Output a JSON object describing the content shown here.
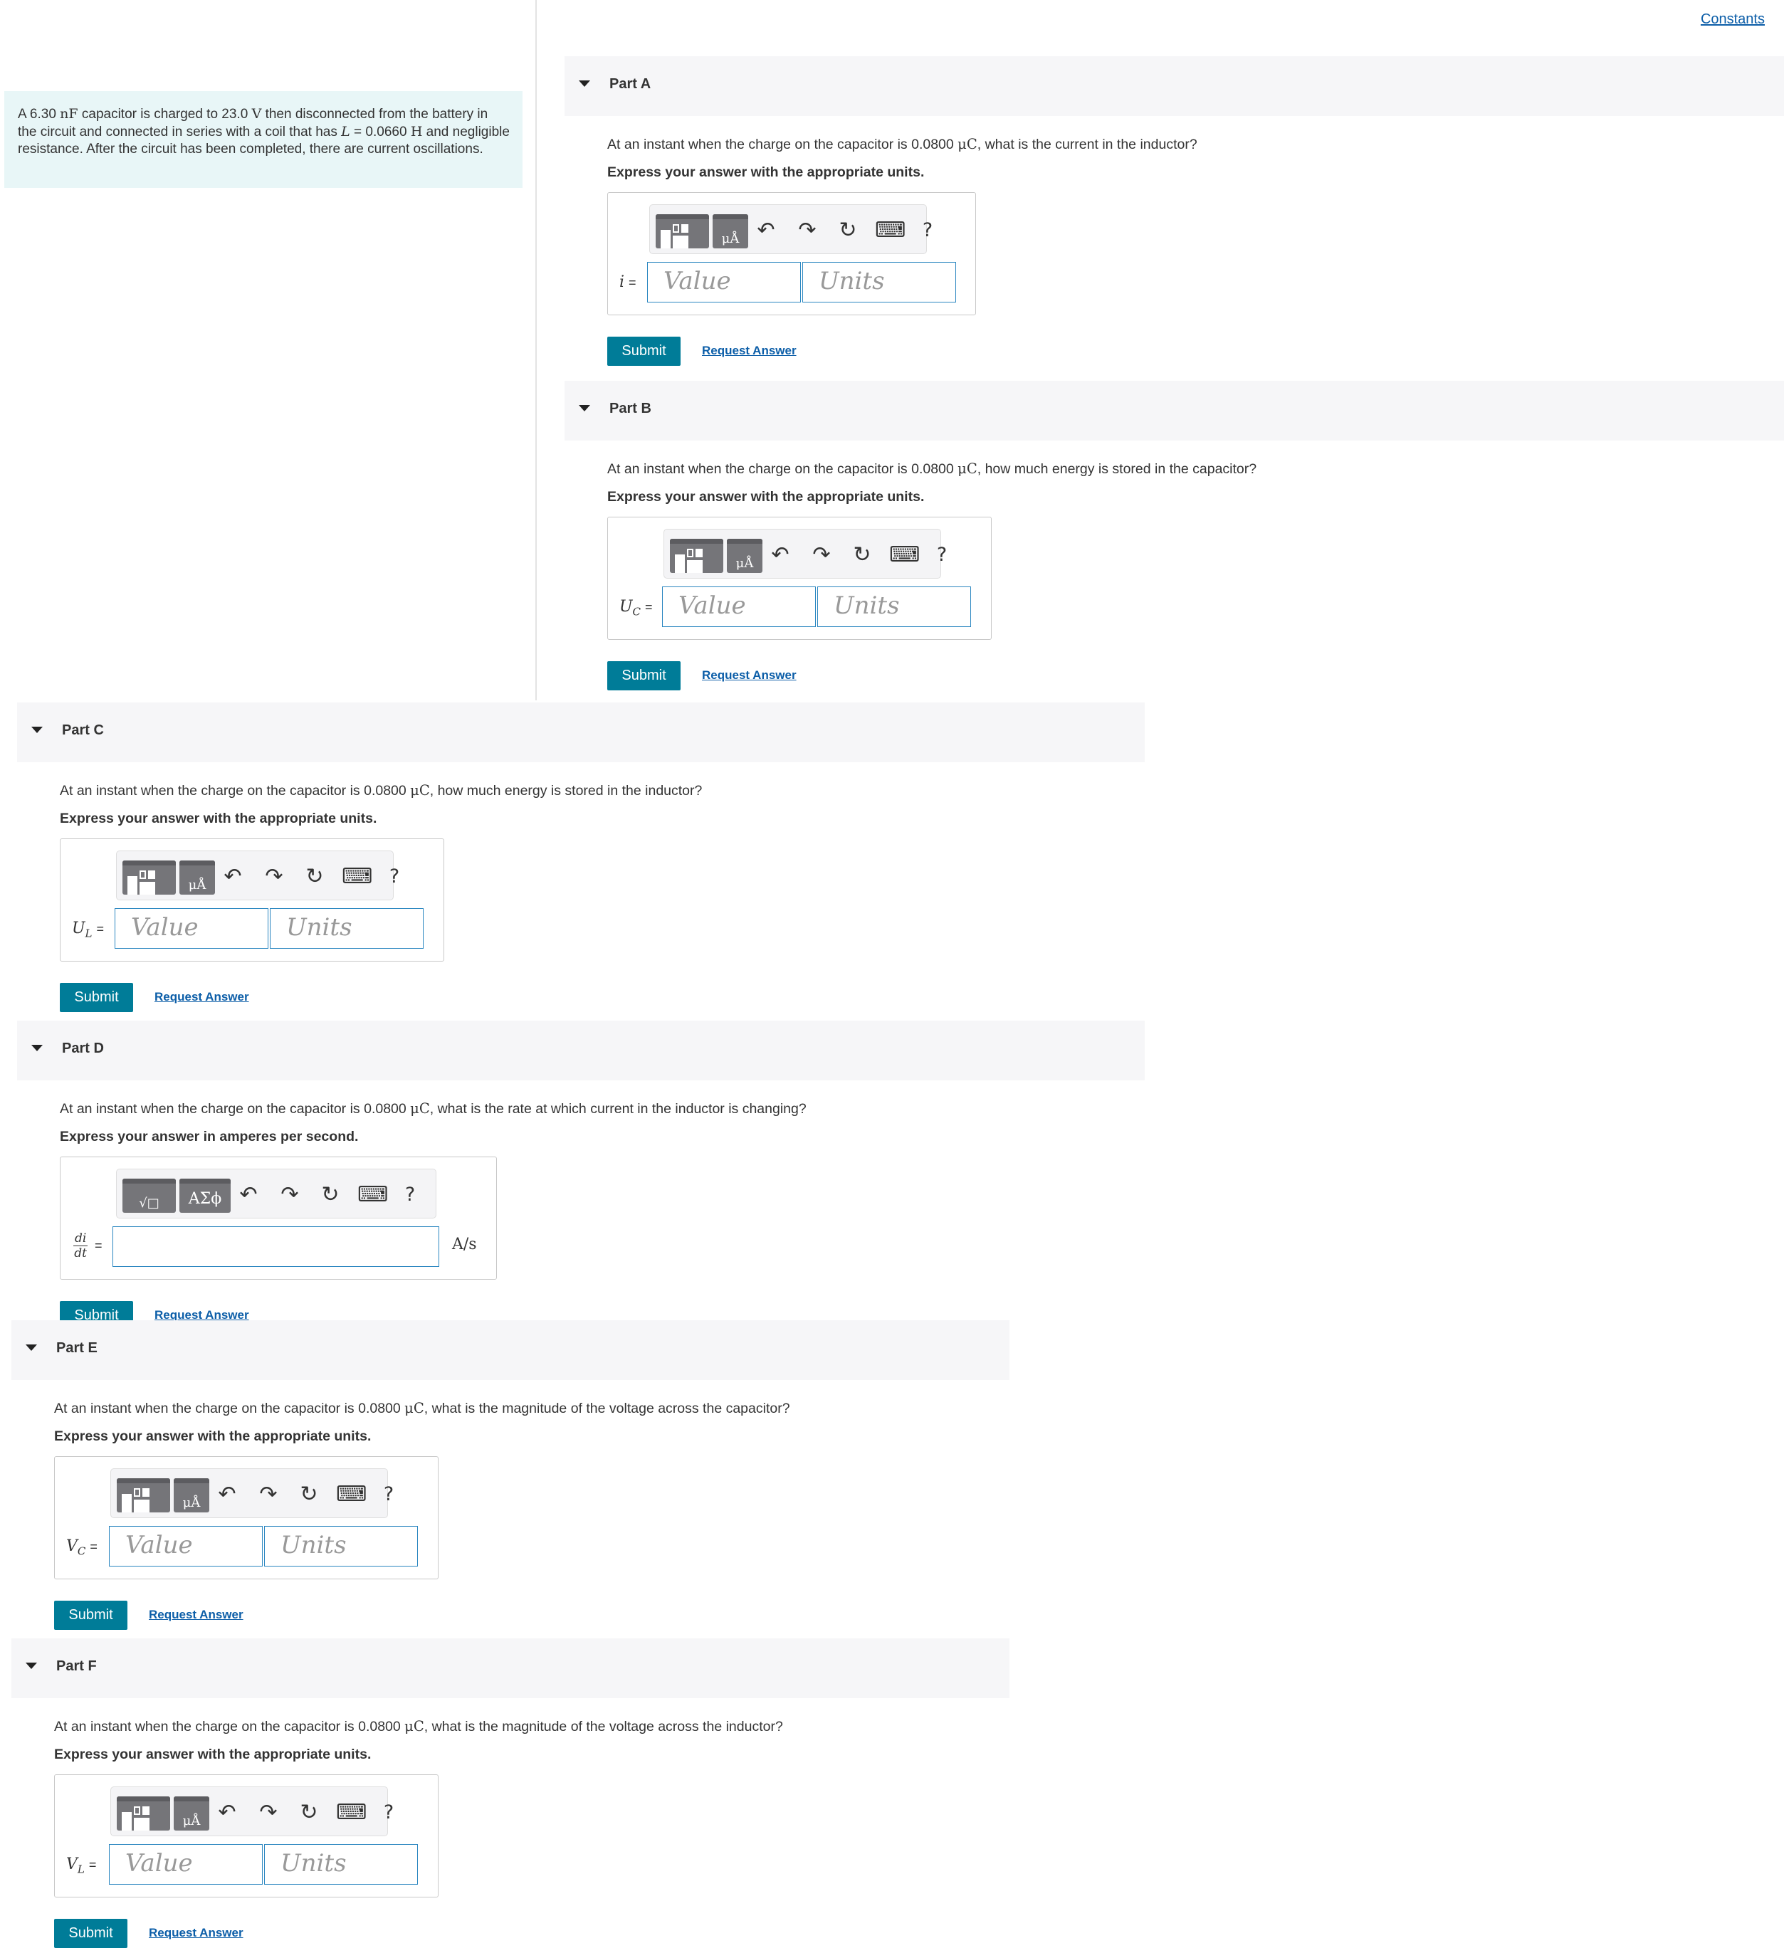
{
  "header": {
    "constants_link": "Constants"
  },
  "intro": {
    "segments": [
      "A 6.30 ",
      "nF",
      " capacitor is charged to 23.0 ",
      "V",
      " then disconnected from the battery in the circuit and connected in series with a coil that has ",
      "L",
      " = 0.0660 ",
      "H",
      " and negligible resistance. After the circuit has been completed, there are current oscillations."
    ]
  },
  "toolbar": {
    "template_icon": "template-icon",
    "units_glyph": "μÅ",
    "math_glyph": "√□",
    "greek_glyph": "ΑΣϕ",
    "undo": "↶",
    "redo": "↷",
    "reset": "↻",
    "keyboard": "⌨",
    "help": "?"
  },
  "common": {
    "instruction_units": "Express your answer with the appropriate units.",
    "value_placeholder": "Value",
    "units_placeholder": "Units",
    "submit": "Submit",
    "request_answer": "Request Answer"
  },
  "parts": [
    {
      "title": "Part A",
      "question_pre": "At an instant when the charge on the capacitor is 0.0800 ",
      "question_unit": "μC",
      "question_post": ", what is the current in the inductor?",
      "var": "i",
      "var_sub": "",
      "equals": "="
    },
    {
      "title": "Part B",
      "question_pre": "At an instant when the charge on the capacitor is 0.0800 ",
      "question_unit": "μC",
      "question_post": ", how much energy is stored in the capacitor?",
      "var": "U",
      "var_sub": "C",
      "equals": "="
    },
    {
      "title": "Part C",
      "question_pre": "At an instant when the charge on the capacitor is 0.0800 ",
      "question_unit": "μC",
      "question_post": ", how much energy is stored in the inductor?",
      "var": "U",
      "var_sub": "L",
      "equals": "="
    },
    {
      "title": "Part D",
      "question_pre": "At an instant when the charge on the capacitor is 0.0800 ",
      "question_unit": "μC",
      "question_post": ", what is the rate at which current in the inductor is changing?",
      "instruction": "Express your answer in amperes per second.",
      "frac_num": "di",
      "frac_den": "dt",
      "equals": "=",
      "unit_suffix": "A/s"
    },
    {
      "title": "Part E",
      "question_pre": "At an instant when the charge on the capacitor is 0.0800 ",
      "question_unit": "μC",
      "question_post": ", what is the magnitude of the voltage across the capacitor?",
      "var": "V",
      "var_sub": "C",
      "equals": "="
    },
    {
      "title": "Part F",
      "question_pre": "At an instant when the charge on the capacitor is 0.0800 ",
      "question_unit": "μC",
      "question_post": ", what is the magnitude of the voltage across the inductor?",
      "var": "V",
      "var_sub": "L",
      "equals": "="
    }
  ]
}
